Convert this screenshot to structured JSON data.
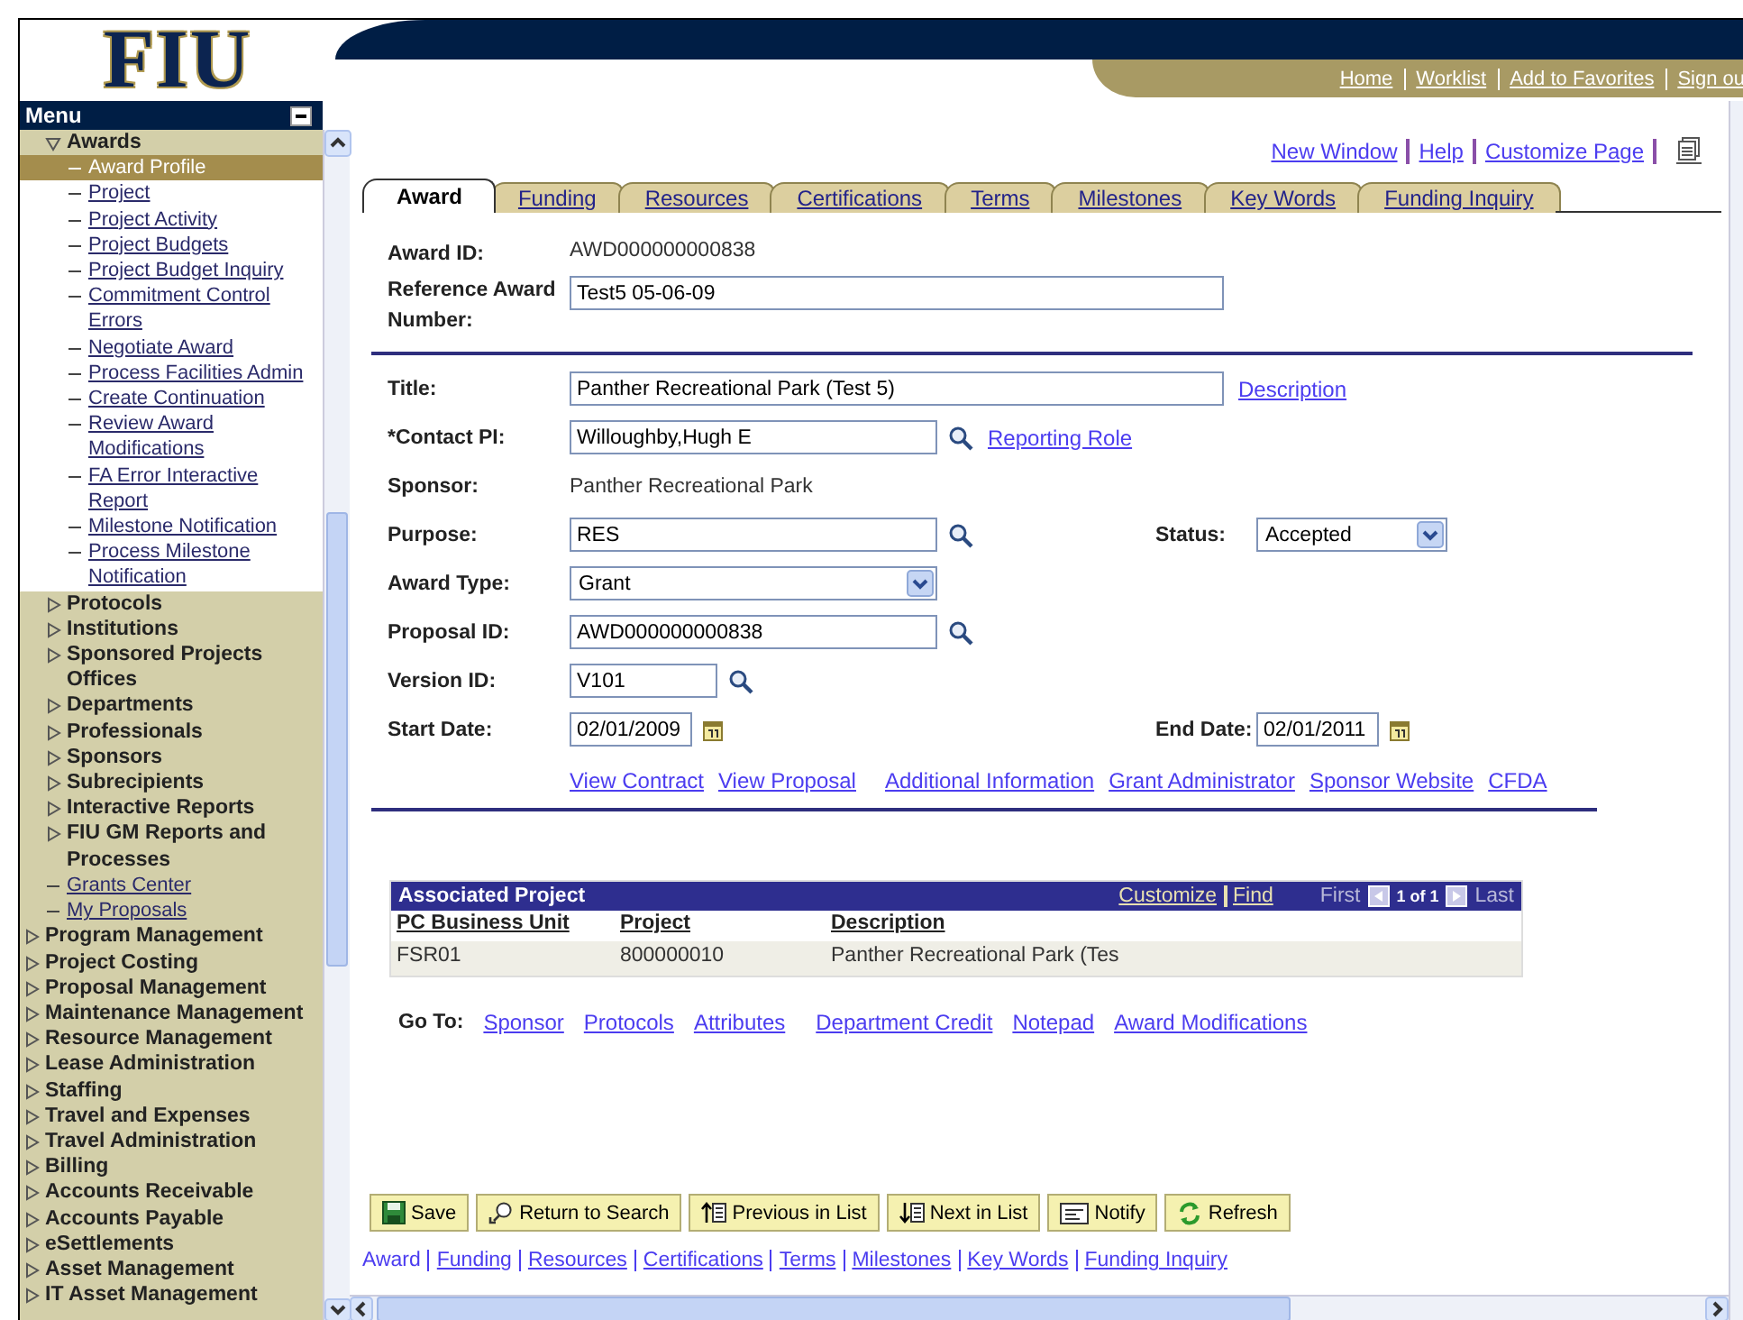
{
  "header": {
    "logo": "FIU",
    "links": [
      "Home",
      "Worklist",
      "Add to Favorites",
      "Sign ou"
    ]
  },
  "menu": {
    "title": "Menu",
    "items": [
      {
        "children": [
          {
            "kind": "folder",
            "label": "Awards",
            "expanded": true,
            "selected": false,
            "children": [
              {
                "kind": "link",
                "label": "Award Profile",
                "selected": true
              },
              {
                "kind": "link",
                "label": "Project",
                "selected": false
              },
              {
                "kind": "link",
                "label": "Project Activity",
                "selected": false
              },
              {
                "kind": "link",
                "label": "Project Budgets",
                "selected": false
              },
              {
                "kind": "link",
                "label": "Project Budget Inquiry",
                "selected": false
              },
              {
                "kind": "link",
                "label": "Commitment Control Errors",
                "selected": false
              },
              {
                "kind": "link",
                "label": "Negotiate Award",
                "selected": false
              },
              {
                "kind": "link",
                "label": "Process Facilities Admin",
                "selected": false
              },
              {
                "kind": "link",
                "label": "Create Continuation",
                "selected": false
              },
              {
                "kind": "link",
                "label": "Review Award Modifications",
                "selected": false
              },
              {
                "kind": "link",
                "label": "FA Error Interactive Report",
                "selected": false
              },
              {
                "kind": "link",
                "label": "Milestone Notification",
                "selected": false
              },
              {
                "kind": "link",
                "label": "Process Milestone Notification",
                "selected": false
              }
            ]
          },
          {
            "kind": "folder",
            "label": "Protocols",
            "expanded": false,
            "selected": false
          },
          {
            "kind": "folder",
            "label": "Institutions",
            "expanded": false,
            "selected": false
          },
          {
            "kind": "folder",
            "label": "Sponsored Projects Offices",
            "expanded": false,
            "selected": false
          },
          {
            "kind": "folder",
            "label": "Departments",
            "expanded": false,
            "selected": false
          },
          {
            "kind": "folder",
            "label": "Professionals",
            "expanded": false,
            "selected": false
          },
          {
            "kind": "folder",
            "label": "Sponsors",
            "expanded": false,
            "selected": false
          },
          {
            "kind": "folder",
            "label": "Subrecipients",
            "expanded": false,
            "selected": false
          },
          {
            "kind": "folder",
            "label": "Interactive Reports",
            "expanded": false,
            "selected": false
          },
          {
            "kind": "folder",
            "label": "FIU GM Reports and Processes",
            "expanded": false,
            "selected": false
          },
          {
            "kind": "link",
            "label": "Grants Center",
            "selected": false
          },
          {
            "kind": "link",
            "label": "My Proposals",
            "selected": false
          }
        ]
      },
      {
        "kind": "folder",
        "label": "Program Management",
        "expanded": false,
        "selected": false
      },
      {
        "kind": "folder",
        "label": "Project Costing",
        "expanded": false,
        "selected": false
      },
      {
        "kind": "folder",
        "label": "Proposal Management",
        "expanded": false,
        "selected": false
      },
      {
        "kind": "folder",
        "label": "Maintenance Management",
        "expanded": false,
        "selected": false
      },
      {
        "kind": "folder",
        "label": "Resource Management",
        "expanded": false,
        "selected": false
      },
      {
        "kind": "folder",
        "label": "Lease Administration",
        "expanded": false,
        "selected": false
      },
      {
        "kind": "folder",
        "label": "Staffing",
        "expanded": false,
        "selected": false
      },
      {
        "kind": "folder",
        "label": "Travel and Expenses",
        "expanded": false,
        "selected": false
      },
      {
        "kind": "folder",
        "label": "Travel Administration",
        "expanded": false,
        "selected": false
      },
      {
        "kind": "folder",
        "label": "Billing",
        "expanded": false,
        "selected": false
      },
      {
        "kind": "folder",
        "label": "Accounts Receivable",
        "expanded": false,
        "selected": false
      },
      {
        "kind": "folder",
        "label": "Accounts Payable",
        "expanded": false,
        "selected": false
      },
      {
        "kind": "folder",
        "label": "eSettlements",
        "expanded": false,
        "selected": false
      },
      {
        "kind": "folder",
        "label": "Asset Management",
        "expanded": false,
        "selected": false
      },
      {
        "kind": "folder",
        "label": "IT Asset Management",
        "expanded": false,
        "selected": false
      }
    ]
  },
  "page_links": [
    "New Window",
    "Help",
    "Customize Page"
  ],
  "tabs": [
    {
      "label": "Award",
      "selected": true
    },
    {
      "label": "Funding",
      "selected": false
    },
    {
      "label": "Resources",
      "selected": false
    },
    {
      "label": "Certifications",
      "selected": false
    },
    {
      "label": "Terms",
      "selected": false
    },
    {
      "label": "Milestones",
      "selected": false
    },
    {
      "label": "Key Words",
      "selected": false
    },
    {
      "label": "Funding Inquiry",
      "selected": false
    }
  ],
  "identity": [
    {
      "label": "Award ID:",
      "kind": "text",
      "value": "AWD000000000838"
    },
    {
      "label": "Reference Award Number:",
      "kind": "input",
      "value": "Test5 05-06-09"
    }
  ],
  "fields": [
    {
      "label": "Title:",
      "kind": "input",
      "value": "Panther Recreational Park (Test 5)",
      "link": "Description"
    },
    {
      "label": "*Contact PI:",
      "kind": "input",
      "value": "Willoughby,Hugh E",
      "lookup": true,
      "link": "Reporting Role"
    },
    {
      "label": "Sponsor:",
      "kind": "text",
      "value": "Panther Recreational Park"
    },
    {
      "label": "Purpose:",
      "kind": "input",
      "value": "RES",
      "lookup": true,
      "aside": {
        "label": "Status:",
        "kind": "select",
        "value": "Accepted"
      }
    },
    {
      "label": "Award Type:",
      "kind": "select",
      "value": "Grant"
    },
    {
      "label": "Proposal ID:",
      "kind": "input",
      "value": "AWD000000000838",
      "lookup": true
    },
    {
      "label": "Version ID:",
      "kind": "input",
      "value": "V101",
      "lookup": true
    },
    {
      "label": "Start Date:",
      "kind": "date",
      "value": "02/01/2009",
      "aside": {
        "label": "End Date:",
        "kind": "date",
        "value": "02/01/2011"
      }
    }
  ],
  "related_links": [
    "View Contract",
    "View Proposal",
    "Additional Information",
    "Grant Administrator",
    "Sponsor Website",
    "CFDA"
  ],
  "grid": {
    "title": "Associated Project",
    "links": [
      "Customize",
      "Find"
    ],
    "first": "First",
    "count": "1 of 1",
    "last": "Last",
    "columns": [
      "PC Business Unit",
      "Project",
      "Description"
    ],
    "rows": [
      [
        "FSR01",
        "800000010",
        "Panther Recreational Park (Tes"
      ]
    ]
  },
  "goto": {
    "label": "Go To:",
    "links": [
      "Sponsor",
      "Protocols",
      "Attributes",
      "Department Credit",
      "Notepad",
      "Award Modifications"
    ]
  },
  "buttons": [
    {
      "kind": "save",
      "label": "Save"
    },
    {
      "kind": "return",
      "label": "Return to Search"
    },
    {
      "kind": "previous",
      "label": "Previous in List"
    },
    {
      "kind": "next",
      "label": "Next in List"
    },
    {
      "kind": "notify",
      "label": "Notify"
    },
    {
      "kind": "refresh",
      "label": "Refresh"
    }
  ],
  "bottom_links": [
    {
      "label": "Award",
      "selected": true
    },
    {
      "label": "Funding",
      "selected": false
    },
    {
      "label": "Resources",
      "selected": false
    },
    {
      "label": "Certifications",
      "selected": false
    },
    {
      "label": "Terms",
      "selected": false
    },
    {
      "label": "Milestones",
      "selected": false
    },
    {
      "label": "Key Words",
      "selected": false
    },
    {
      "label": "Funding Inquiry",
      "selected": false
    }
  ]
}
